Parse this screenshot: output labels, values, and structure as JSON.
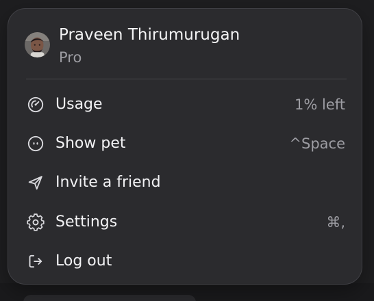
{
  "profile": {
    "name": "Praveen Thirumurugan",
    "plan": "Pro",
    "avatar_icon": "user-avatar"
  },
  "menu": {
    "items": [
      {
        "label": "Usage",
        "trailing": "1% left",
        "icon": "speedometer-icon"
      },
      {
        "label": "Show pet",
        "trailing": "^Space",
        "icon": "pet-icon"
      },
      {
        "label": "Invite a friend",
        "trailing": "",
        "icon": "paper-plane-icon"
      },
      {
        "label": "Settings",
        "trailing": "⌘,",
        "icon": "gear-icon"
      },
      {
        "label": "Log out",
        "trailing": "",
        "icon": "log-out-icon"
      }
    ]
  },
  "theme": {
    "menu_background": "#2b2b2e",
    "text_primary": "#f2f2f4",
    "text_secondary": "#9d9da3",
    "divider": "#48484d"
  }
}
